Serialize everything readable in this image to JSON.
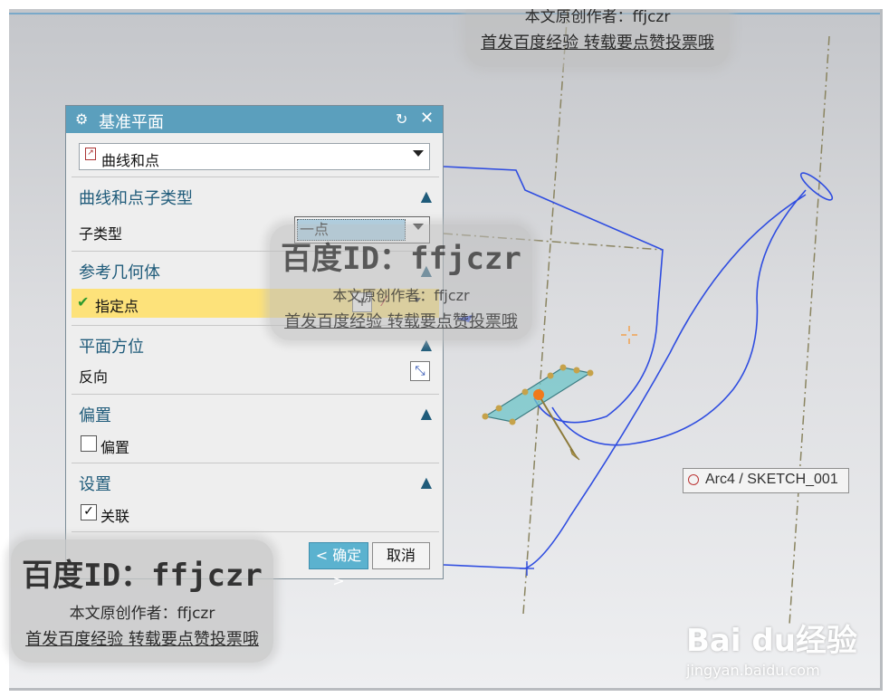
{
  "dialog": {
    "title": "基准平面",
    "type_value": "曲线和点",
    "sections": {
      "subtype": {
        "header": "曲线和点子类型",
        "field_label": "子类型",
        "field_value": "一点"
      },
      "reference": {
        "header": "参考几何体",
        "specify_point": "指定点"
      },
      "orientation": {
        "header": "平面方位",
        "reverse_label": "反向"
      },
      "offset": {
        "header": "偏置",
        "checkbox_label": "偏置",
        "checked": false
      },
      "settings": {
        "header": "设置",
        "checkbox_label": "关联",
        "checked": true
      }
    },
    "ok_label": "< 确定 >",
    "cancel_label": "取消"
  },
  "tooltip": {
    "text": "Arc4 / SKETCH_001"
  },
  "watermarks": {
    "id_text": "百度ID：ffjczr",
    "author_text": "本文原创作者：ffjczr",
    "promo_text": "首发百度经验 转载要点赞投票哦"
  },
  "logo": {
    "brand": "Bai du经验",
    "url_text": "jingyan.baidu.com"
  },
  "colors": {
    "title_bar": "#5b9fbd",
    "highlight_row": "#fde27a",
    "curve": "#2f4de0",
    "axis_dash": "#8a8460",
    "plane_fill": "#6ec4c8",
    "ok_button": "#5bb2cf"
  }
}
